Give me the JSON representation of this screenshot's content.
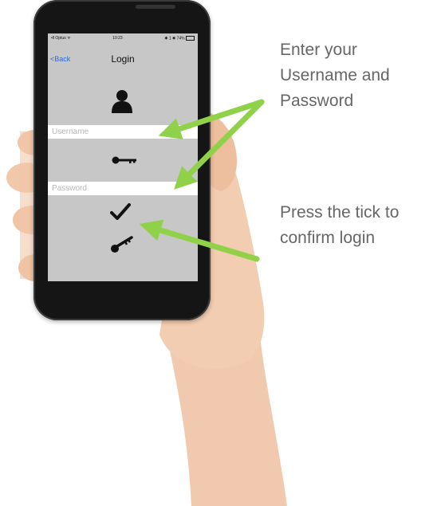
{
  "status_bar": {
    "carrier": "•ll Optus ᯤ",
    "time": "10:23",
    "battery": "✱ 1 ✱ 74%"
  },
  "nav": {
    "back_label": "<Back",
    "title": "Login"
  },
  "username": {
    "placeholder": "Username",
    "value": ""
  },
  "password": {
    "placeholder": "Password",
    "value": ""
  },
  "icons": {
    "user": "user-icon",
    "key": "key-icon",
    "tick": "tick-icon",
    "alternate_key": "key-alt-icon"
  },
  "callouts": {
    "credentials_line1": "Enter your",
    "credentials_line2": "Username and",
    "credentials_line3": "Password",
    "confirm_line1": "Press the tick to",
    "confirm_line2": "confirm login"
  },
  "colors": {
    "arrow": "#8fd24a",
    "screen_bg": "#c7c7c7",
    "callout_text": "#666666",
    "back_link": "#2a6ad6"
  }
}
